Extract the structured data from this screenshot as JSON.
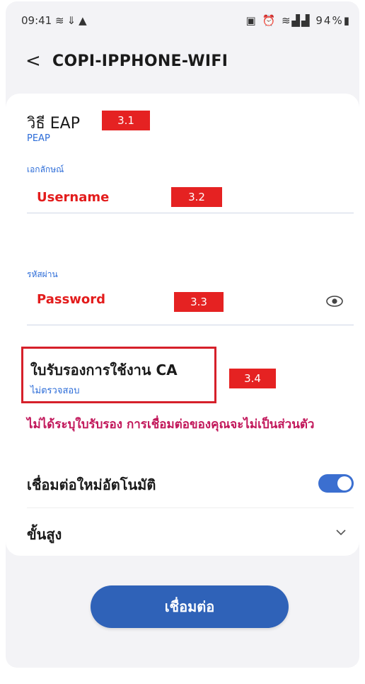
{
  "status_bar": {
    "time": "09:41",
    "left_icons": [
      "wifi-signal-icon",
      "download-icon",
      "warning-icon"
    ],
    "right_icons": [
      "lock-icon",
      "alarm-icon",
      "wifi-icon",
      "signal-icon",
      "signal-icon"
    ],
    "battery": "94%"
  },
  "header": {
    "back_glyph": "<",
    "title": "COPI-IPPHONE-WIFI"
  },
  "eap": {
    "label": "วิธี EAP",
    "value": "PEAP",
    "tag": "3.1"
  },
  "identity": {
    "label": "เอกลักษณ์",
    "placeholder": "Username",
    "tag": "3.2"
  },
  "password": {
    "label": "รหัสผ่าน",
    "placeholder": "Password",
    "tag": "3.3",
    "eye_icon": "eye-icon"
  },
  "ca_certificate": {
    "label": "ใบรับรองการใช้งาน CA",
    "value": "ไม่ตรวจสอบ",
    "tag": "3.4"
  },
  "warning": "ไม่ได้ระบุใบรับรอง การเชื่อมต่อของคุณจะไม่เป็นส่วนตัว",
  "auto_reconnect": {
    "label": "เชื่อมต่อใหม่อัตโนมัติ",
    "enabled": true
  },
  "advanced": {
    "label": "ขั้นสูง"
  },
  "connect_button": "เชื่อมต่อ",
  "colors": {
    "accent": "#2f62b8",
    "tag_red": "#e52222",
    "link_blue": "#2c6cd8",
    "warning": "#c2185b"
  }
}
